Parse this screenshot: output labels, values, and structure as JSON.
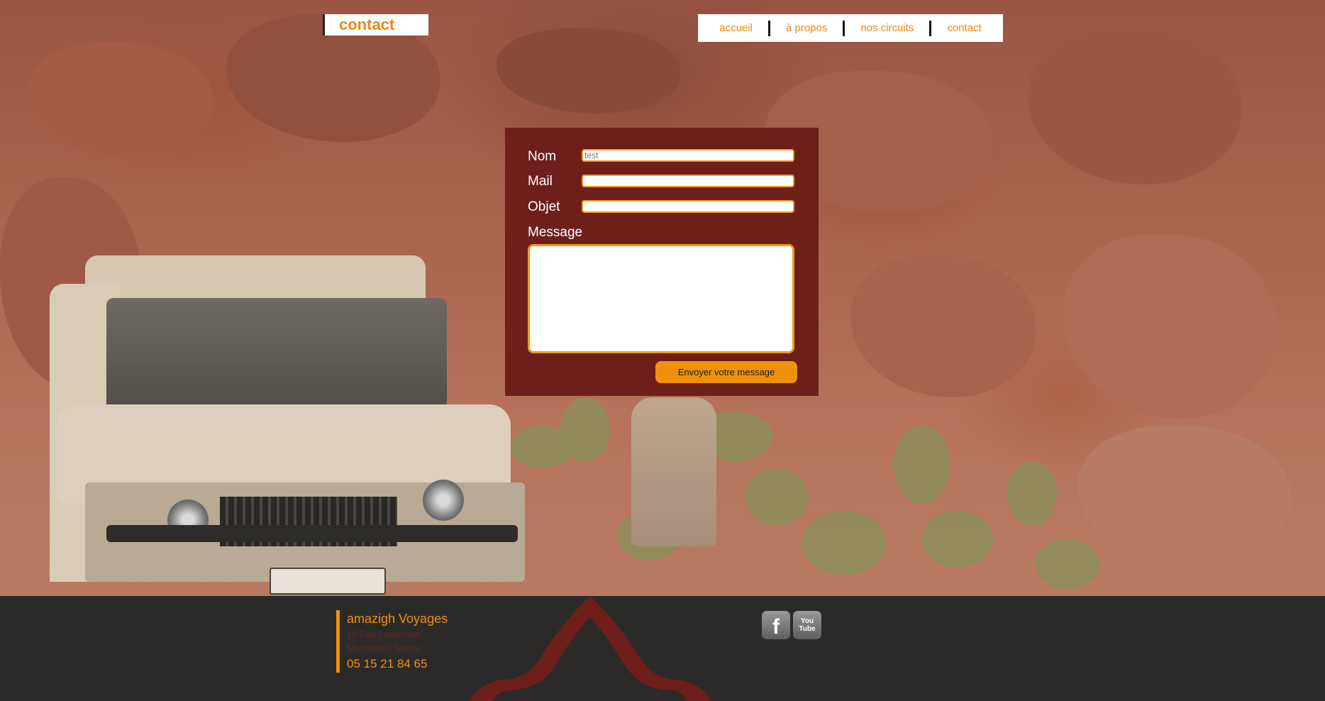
{
  "header": {
    "page_title": "contact"
  },
  "nav": {
    "items": [
      {
        "label": "accueil"
      },
      {
        "label": "à propos"
      },
      {
        "label": "nos circuits"
      },
      {
        "label": "contact"
      }
    ]
  },
  "form": {
    "name_label": "Nom",
    "name_placeholder": "test",
    "mail_label": "Mail",
    "subject_label": "Objet",
    "message_label": "Message",
    "submit_label": "Envoyer votre message"
  },
  "footer": {
    "company": "amazigh Voyages",
    "address_line1": "15 Rue Loubnane",
    "address_line2": "Marrakesh, Maroc",
    "phone": "05 15 21 84 65",
    "social": [
      {
        "icon": "facebook-icon",
        "glyph": "f"
      },
      {
        "icon": "youtube-icon",
        "glyph_top": "You",
        "glyph_bottom": "Tube"
      }
    ]
  },
  "colors": {
    "accent": "#f0900c",
    "form_bg": "#6e1f1a",
    "footer_bg": "#2b2a29"
  }
}
